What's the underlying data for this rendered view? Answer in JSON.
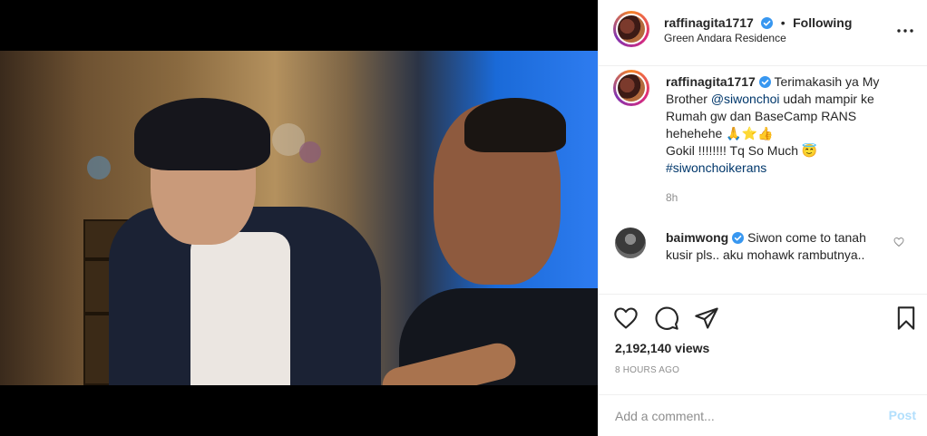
{
  "post": {
    "username": "raffinagita1717",
    "separator": "•",
    "follow_label": "Following",
    "location": "Green Andara Residence"
  },
  "caption": {
    "username": "raffinagita1717",
    "text_1": "Terimakasih ya My Brother ",
    "mention": "@siwonchoi",
    "text_2": " udah mampir ke Rumah gw dan BaseCamp RANS hehehehe 🙏⭐👍",
    "line_2": "Gokil !!!!!!!! Tq So Much 😇",
    "hashtag": "#siwonchoikerans",
    "time": "8h"
  },
  "comment": {
    "username": "baimwong",
    "text": "Siwon come to tanah kusir pls.. aku mohawk rambutnya.."
  },
  "stats": {
    "views": "2,192,140 views",
    "time_ago": "8 HOURS AGO"
  },
  "add_comment": {
    "placeholder": "Add a comment...",
    "post_label": "Post"
  },
  "icons": {
    "more": "more-options-icon",
    "like": "heart-icon",
    "comment": "comment-icon",
    "share": "share-icon",
    "save": "bookmark-icon",
    "user_tag": "user-icon",
    "verified": "verified-badge-icon"
  },
  "colors": {
    "link": "#00376b",
    "verified": "#3897f0",
    "muted": "#8e8e8e",
    "post_disabled": "#b2dffc"
  }
}
